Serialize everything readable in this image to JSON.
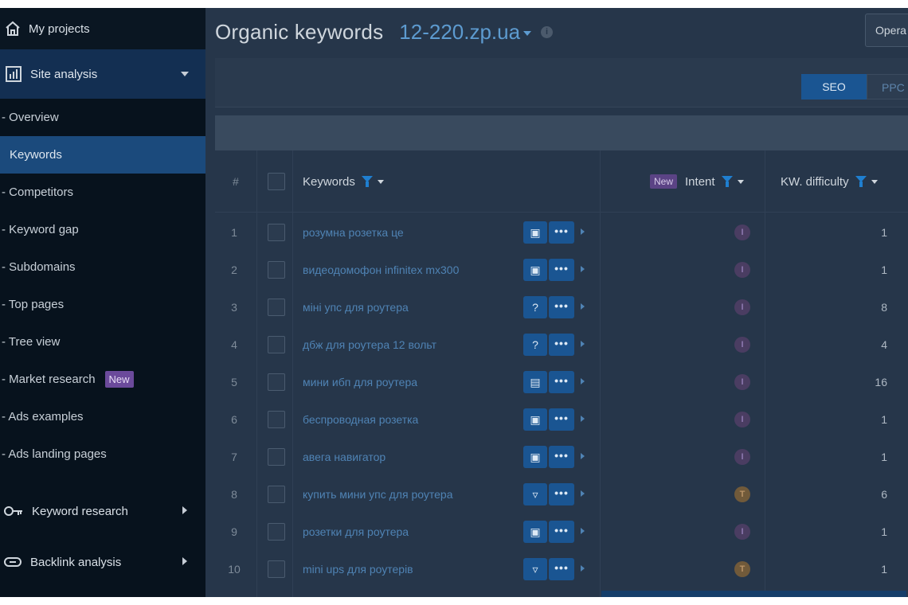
{
  "sidebar": {
    "my_projects": "My projects",
    "site_analysis": "Site analysis",
    "sub_items": [
      {
        "label": "- Overview",
        "active": false,
        "badge": ""
      },
      {
        "label": "Keywords",
        "active": true,
        "badge": ""
      },
      {
        "label": "- Competitors",
        "active": false,
        "badge": ""
      },
      {
        "label": "- Keyword gap",
        "active": false,
        "badge": ""
      },
      {
        "label": "- Subdomains",
        "active": false,
        "badge": ""
      },
      {
        "label": "- Top pages",
        "active": false,
        "badge": ""
      },
      {
        "label": "- Tree view",
        "active": false,
        "badge": ""
      },
      {
        "label": "- Market research",
        "active": false,
        "badge": "New"
      },
      {
        "label": "- Ads examples",
        "active": false,
        "badge": ""
      },
      {
        "label": "- Ads landing pages",
        "active": false,
        "badge": ""
      }
    ],
    "keyword_research": "Keyword research",
    "backlink_analysis": "Backlink analysis"
  },
  "header": {
    "title": "Organic keywords",
    "domain": "12-220.zp.ua",
    "info": "i",
    "top_button": "Opera"
  },
  "toolbar": {
    "seo": "SEO",
    "ppc": "PPC"
  },
  "table": {
    "columns": {
      "num": "#",
      "keywords": "Keywords",
      "new_badge": "New",
      "intent": "Intent",
      "kd": "KW. difficulty"
    },
    "rows": [
      {
        "n": "1",
        "keyword": "розумна розетка це",
        "icon": "store-icon",
        "intent": "I",
        "intent_type": "i",
        "kd": "1"
      },
      {
        "n": "2",
        "keyword": "видеодомофон infinitex mx300",
        "icon": "store-icon",
        "intent": "I",
        "intent_type": "i",
        "kd": "1"
      },
      {
        "n": "3",
        "keyword": "міні упс для роутера",
        "icon": "question-icon",
        "intent": "I",
        "intent_type": "i",
        "kd": "8"
      },
      {
        "n": "4",
        "keyword": "дбж для роутера 12 вольт",
        "icon": "question-icon",
        "intent": "I",
        "intent_type": "i",
        "kd": "4"
      },
      {
        "n": "5",
        "keyword": "мини ибп для роутера",
        "icon": "chat-icon",
        "intent": "I",
        "intent_type": "i",
        "kd": "16"
      },
      {
        "n": "6",
        "keyword": "беспроводная розетка",
        "icon": "store-icon",
        "intent": "I",
        "intent_type": "i",
        "kd": "1"
      },
      {
        "n": "7",
        "keyword": "авега навигатор",
        "icon": "store-icon",
        "intent": "I",
        "intent_type": "i",
        "kd": "1"
      },
      {
        "n": "8",
        "keyword": "купить мини упс для роутера",
        "icon": "trophy-icon",
        "intent": "T",
        "intent_type": "t",
        "kd": "6"
      },
      {
        "n": "9",
        "keyword": "розетки для роутера",
        "icon": "store-icon",
        "intent": "I",
        "intent_type": "i",
        "kd": "1"
      },
      {
        "n": "10",
        "keyword": "mini ups для роутерів",
        "icon": "trophy-icon",
        "intent": "T",
        "intent_type": "t",
        "kd": "1"
      }
    ]
  },
  "icons": {
    "store-icon": "▣",
    "question-icon": "?",
    "chat-icon": "▤",
    "trophy-icon": "▿",
    "more": "•••"
  }
}
